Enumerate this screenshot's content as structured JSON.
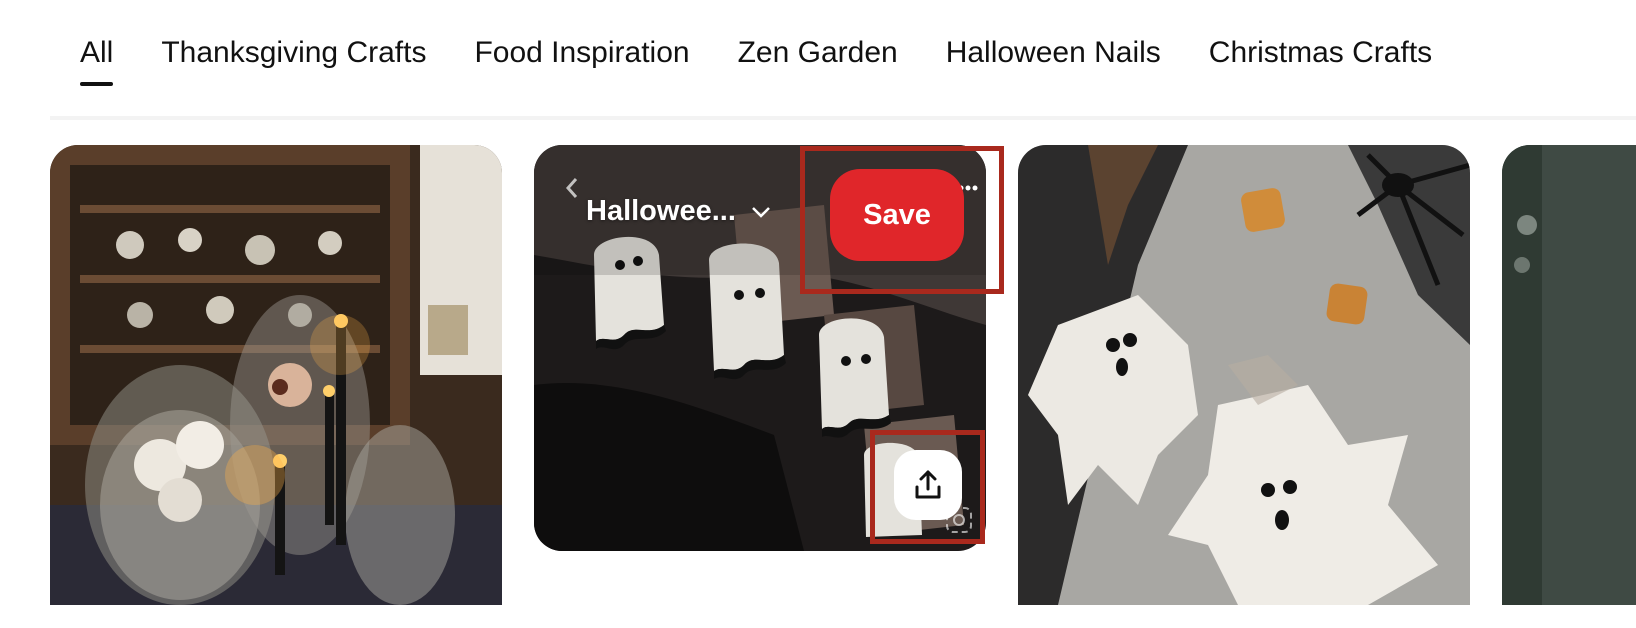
{
  "tabs": [
    {
      "label": "All",
      "active": true
    },
    {
      "label": "Thanksgiving Crafts",
      "active": false
    },
    {
      "label": "Food Inspiration",
      "active": false
    },
    {
      "label": "Zen Garden",
      "active": false
    },
    {
      "label": "Halloween Nails",
      "active": false
    },
    {
      "label": "Christmas Crafts",
      "active": false
    }
  ],
  "pins": {
    "table": {
      "description": "Halloween apothecary jars with skulls and candles"
    },
    "nails": {
      "board_select_label": "Hallowee...",
      "save_label": "Save",
      "share_icon": "share-upload-icon",
      "more_icon": "more-dots-icon",
      "lens_icon": "visual-search-icon"
    },
    "leaves": {
      "description": "Ghost leaves and pumpkin confetti"
    },
    "forest": {
      "description": "Forest photo partially visible"
    }
  },
  "colors": {
    "save_button": "#e0262a",
    "highlight_box": "#a9291d",
    "active_tab_underline": "#111111"
  }
}
